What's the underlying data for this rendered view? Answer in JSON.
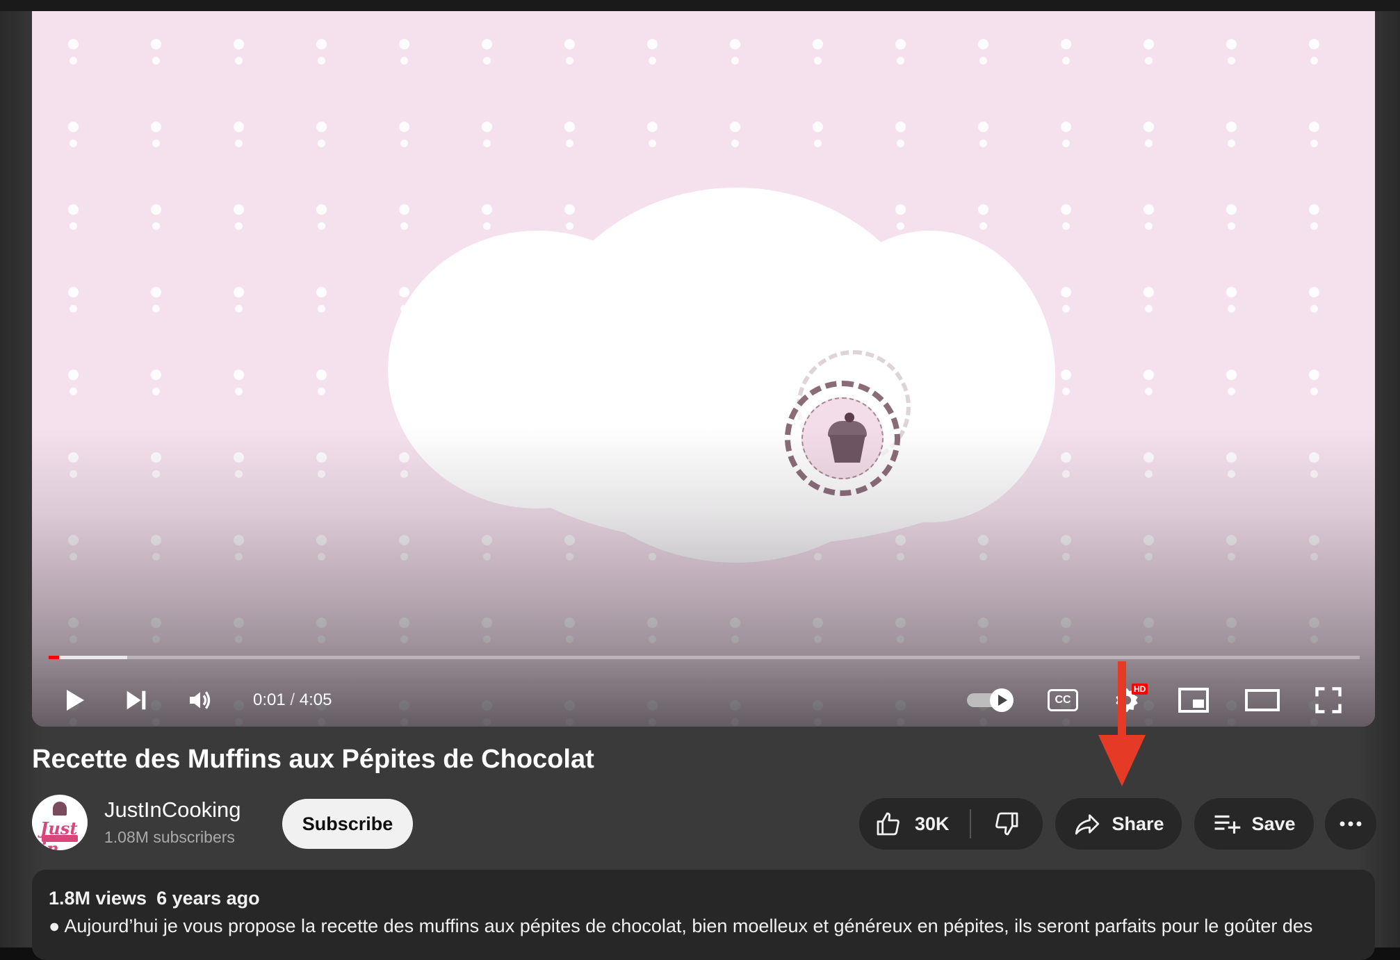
{
  "player": {
    "current_time": "0:01",
    "time_separator": "/",
    "duration": "4:05",
    "progress_played_fraction": 0.008,
    "progress_buffered_fraction": 0.06,
    "hd_badge": "HD",
    "cc_label": "CC"
  },
  "video": {
    "title": "Recette des Muffins aux Pépites de Chocolat"
  },
  "channel": {
    "name": "JustInCooking",
    "subscribers": "1.08M subscribers",
    "subscribe_label": "Subscribe",
    "avatar_text": "Just in"
  },
  "actions": {
    "like_count": "30K",
    "share_label": "Share",
    "save_label": "Save"
  },
  "description": {
    "views": "1.8M views",
    "age": "6 years ago",
    "text": "● Aujourd’hui je vous propose la recette des muffins aux pépites de chocolat, bien moelleux et généreux en pépites, ils seront parfaits pour le goûter des"
  },
  "colors": {
    "accent_red": "#ff0000",
    "annotation_arrow": "#e53a25",
    "video_bg": "#f5e1ee"
  }
}
